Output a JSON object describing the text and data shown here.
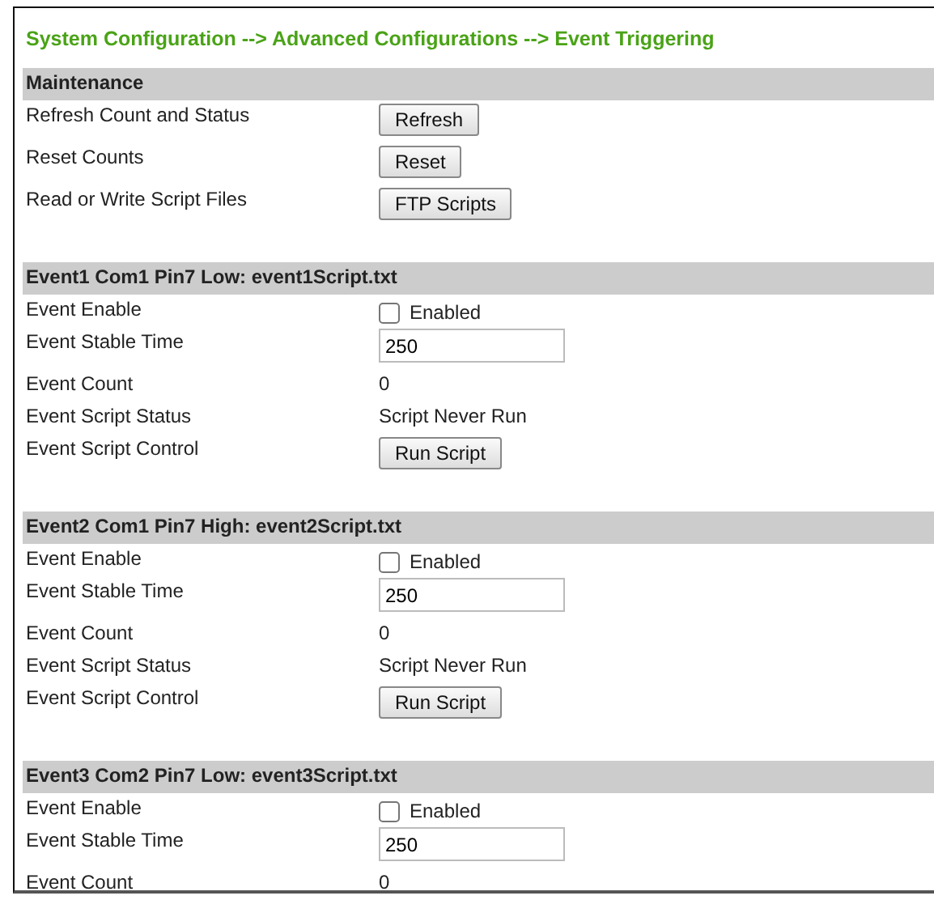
{
  "breadcrumb": "System Configuration --> Advanced Configurations --> Event Triggering",
  "sections": [
    {
      "title": "Maintenance",
      "rows": [
        {
          "label": "Refresh Count and Status",
          "kind": "button",
          "value": "Refresh"
        },
        {
          "label": "Reset Counts",
          "kind": "button",
          "value": "Reset"
        },
        {
          "label": "Read or Write Script Files",
          "kind": "button",
          "value": "FTP Scripts"
        }
      ]
    },
    {
      "title": "Event1 Com1 Pin7 Low: event1Script.txt",
      "rows": [
        {
          "label": "Event Enable",
          "kind": "checkbox",
          "value": "Enabled",
          "checked": false
        },
        {
          "label": "Event Stable Time",
          "kind": "input",
          "value": "250"
        },
        {
          "label": "Event Count",
          "kind": "text",
          "value": "0"
        },
        {
          "label": "Event Script Status",
          "kind": "text",
          "value": "Script Never Run"
        },
        {
          "label": "Event Script Control",
          "kind": "button",
          "value": "Run Script"
        }
      ]
    },
    {
      "title": "Event2 Com1 Pin7 High: event2Script.txt",
      "rows": [
        {
          "label": "Event Enable",
          "kind": "checkbox",
          "value": "Enabled",
          "checked": false
        },
        {
          "label": "Event Stable Time",
          "kind": "input",
          "value": "250"
        },
        {
          "label": "Event Count",
          "kind": "text",
          "value": "0"
        },
        {
          "label": "Event Script Status",
          "kind": "text",
          "value": "Script Never Run"
        },
        {
          "label": "Event Script Control",
          "kind": "button",
          "value": "Run Script"
        }
      ]
    },
    {
      "title": "Event3 Com2 Pin7 Low: event3Script.txt",
      "rows": [
        {
          "label": "Event Enable",
          "kind": "checkbox",
          "value": "Enabled",
          "checked": false
        },
        {
          "label": "Event Stable Time",
          "kind": "input",
          "value": "250"
        },
        {
          "label": "Event Count",
          "kind": "text",
          "value": "0"
        }
      ]
    }
  ]
}
